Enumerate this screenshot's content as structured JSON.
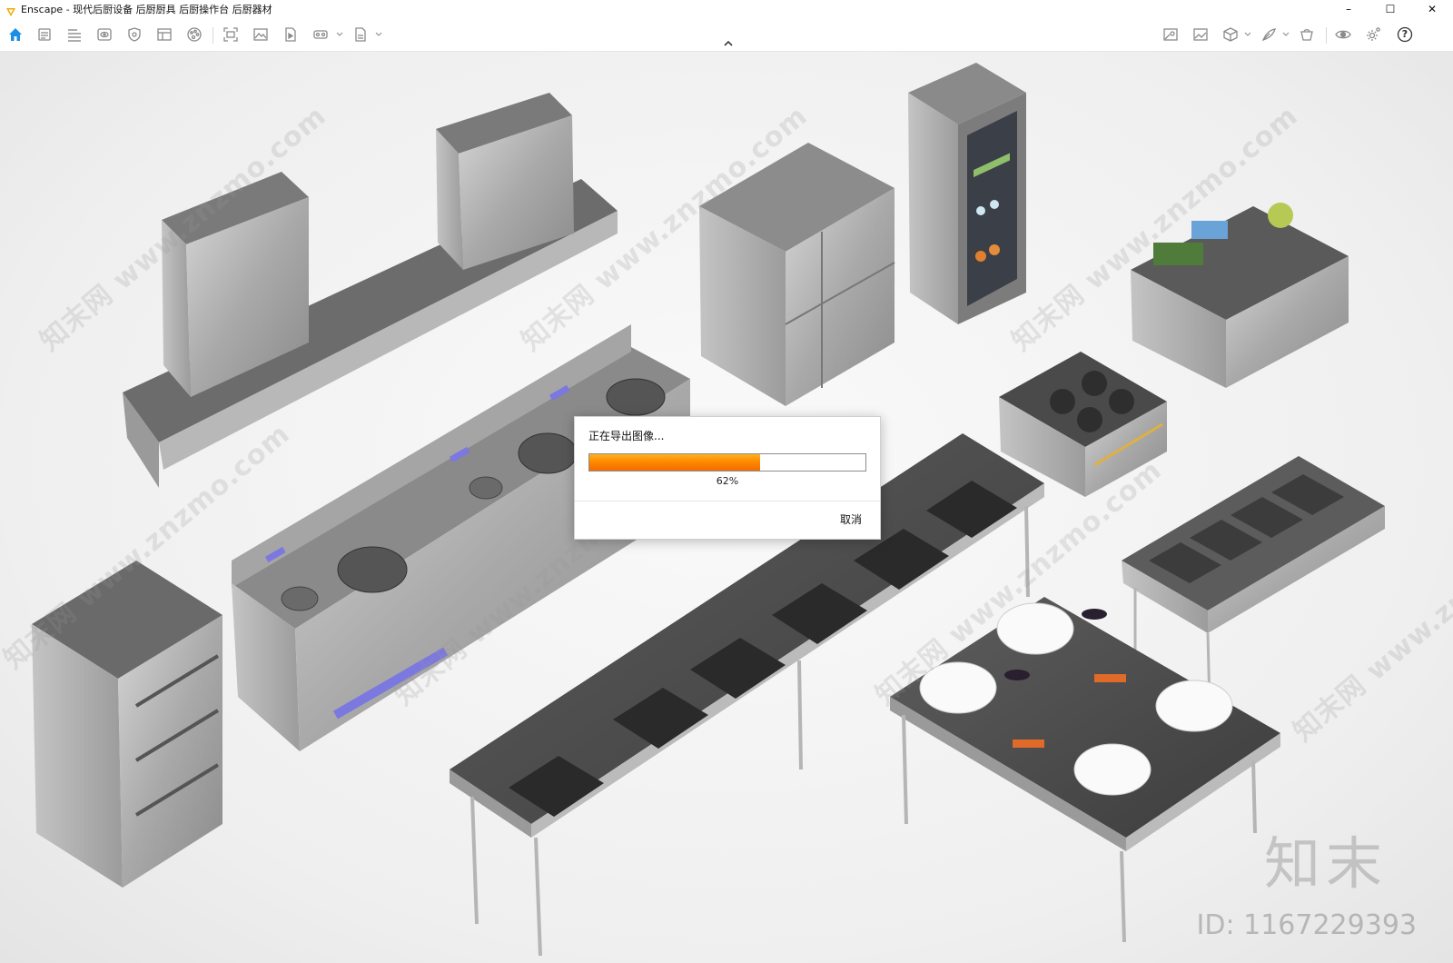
{
  "window": {
    "app_name": "Enscape",
    "title": "Enscape - 现代后厨设备 后厨厨具 后厨操作台 后厨器材",
    "controls": {
      "minimize": "–",
      "maximize": "☐",
      "close": "✕"
    }
  },
  "toolbar": {
    "left_icons": [
      "home-icon",
      "document-icon",
      "list-icon",
      "eye-view-icon",
      "shield-icon",
      "grid-table-icon",
      "color-palette-icon",
      "capture-screenshot-icon",
      "image-icon",
      "video-file-icon",
      "vr-headset-icon",
      "export-file-icon"
    ],
    "right_icons": [
      "map-icon",
      "picture-icon",
      "cube-icon",
      "feather-icon",
      "asset-library-icon",
      "visibility-eye-icon",
      "settings-gear-icon",
      "help-icon"
    ],
    "help_label": "?",
    "accent_color": "#1a8fe3"
  },
  "viewport": {
    "watermark_text": "知末网 www.znzmo.com",
    "brand_mark": "知末",
    "brand_id": "ID: 1167229393"
  },
  "export_dialog": {
    "title": "正在导出图像...",
    "progress": 0.62,
    "progress_label": "62%",
    "cancel_label": "取消",
    "progress_colors": [
      "#ffb020",
      "#f26b00"
    ]
  }
}
